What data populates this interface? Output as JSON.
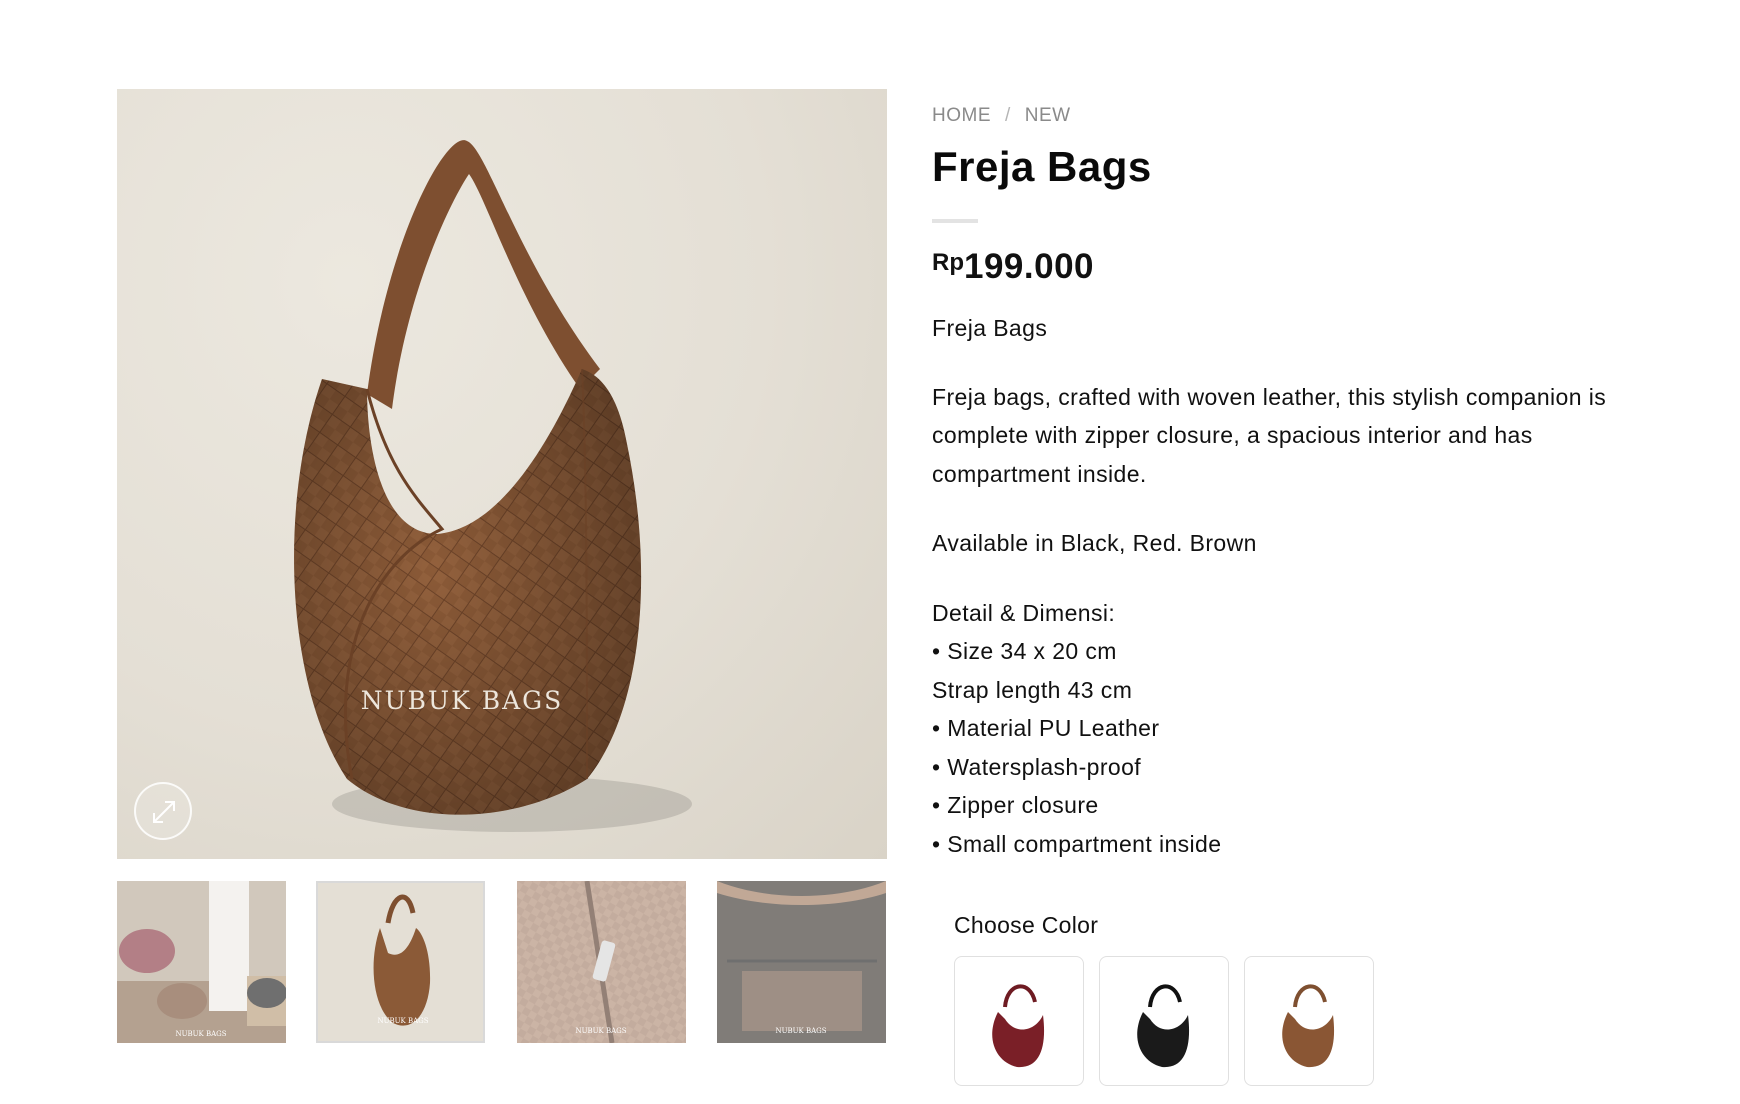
{
  "breadcrumb": {
    "home": "HOME",
    "separator": "/",
    "current": "NEW"
  },
  "product": {
    "title": "Freja Bags",
    "currency": "Rp",
    "price": "199.000",
    "short_name": "Freja Bags",
    "description": "Freja bags, crafted with woven leather, this stylish companion is complete with zipper closure, a spacious interior and has compartment inside.",
    "availability": "Available in Black, Red. Brown",
    "details": [
      "Detail & Dimensi:",
      "• Size 34 x 20 cm",
      "Strap length 43 cm",
      "• Material PU Leather",
      "• Watersplash-proof",
      "• Zipper closure",
      "• Small compartment inside"
    ]
  },
  "gallery": {
    "watermark": "NUBUK BAGS",
    "zoom_icon": "expand-icon",
    "thumbnails": [
      {
        "alt": "lifestyle photo",
        "watermark": "NUBUK BAGS"
      },
      {
        "alt": "brown bag front",
        "watermark": "NUBUK BAGS",
        "active": true
      },
      {
        "alt": "zipper detail",
        "watermark": "NUBUK BAGS"
      },
      {
        "alt": "interior compartment",
        "watermark": "NUBUK BAGS"
      }
    ]
  },
  "color_chooser": {
    "label": "Choose Color",
    "options": [
      {
        "name": "Red",
        "color": "#7a1f27"
      },
      {
        "name": "Black",
        "color": "#1a1a1a"
      },
      {
        "name": "Brown",
        "color": "#8a5634"
      }
    ]
  },
  "colors": {
    "bag_brown": "#8b5a37",
    "background": "#e6e1d7",
    "text": "#111111",
    "muted": "#8a8a8a"
  }
}
